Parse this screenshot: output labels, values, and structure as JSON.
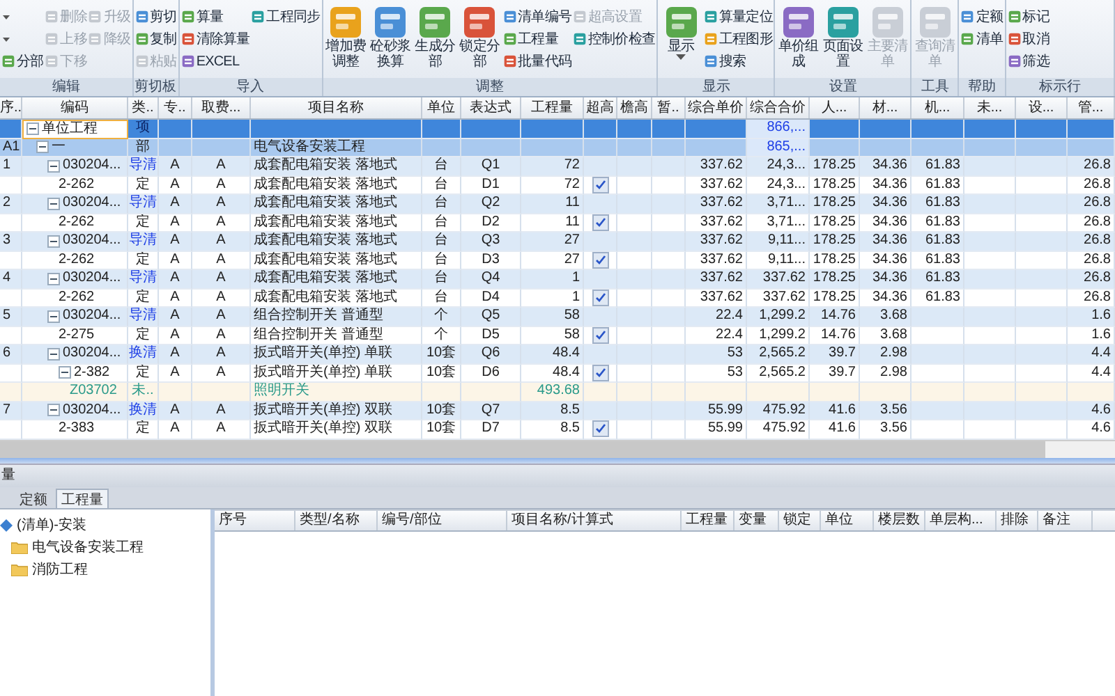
{
  "ribbon": {
    "groups": [
      {
        "label": "编辑",
        "items": [
          {
            "kind": "caret"
          },
          {
            "kind": "caret"
          },
          {
            "kind": "small",
            "label": "分部",
            "disabled": false
          },
          {
            "kind": "small",
            "label": "删除",
            "disabled": true
          },
          {
            "kind": "small",
            "label": "上移",
            "disabled": true
          },
          {
            "kind": "small",
            "label": "下移",
            "disabled": true
          },
          {
            "kind": "small",
            "label": "升级",
            "disabled": true
          },
          {
            "kind": "small",
            "label": "降级",
            "disabled": true
          }
        ]
      },
      {
        "label": "剪切板",
        "items": [
          {
            "kind": "small",
            "label": "剪切",
            "disabled": false
          },
          {
            "kind": "small",
            "label": "复制",
            "disabled": false
          },
          {
            "kind": "small",
            "label": "粘贴",
            "disabled": true
          }
        ]
      },
      {
        "label": "导入",
        "items": [
          {
            "kind": "small",
            "label": "算量",
            "disabled": false
          },
          {
            "kind": "small",
            "label": "清除算量",
            "disabled": false
          },
          {
            "kind": "small",
            "label": "EXCEL",
            "disabled": false
          },
          {
            "kind": "small",
            "label": "工程同步",
            "disabled": false
          }
        ]
      },
      {
        "label": "调整",
        "items": [
          {
            "kind": "large",
            "label": "增加费调整",
            "disabled": false
          },
          {
            "kind": "large",
            "label": "砼砂浆换算",
            "disabled": false
          },
          {
            "kind": "large",
            "label": "生成分部",
            "disabled": false
          },
          {
            "kind": "large",
            "label": "锁定分部",
            "disabled": false
          },
          {
            "kind": "small",
            "label": "清单编号",
            "disabled": false
          },
          {
            "kind": "small",
            "label": "工程量",
            "disabled": false
          },
          {
            "kind": "small",
            "label": "批量代码",
            "disabled": false
          },
          {
            "kind": "small",
            "label": "超高设置",
            "disabled": true
          },
          {
            "kind": "small",
            "label": "控制价检查",
            "disabled": false
          }
        ]
      },
      {
        "label": "显示",
        "items": [
          {
            "kind": "menu",
            "label": "显示",
            "disabled": false
          },
          {
            "kind": "small",
            "label": "算量定位",
            "disabled": false
          },
          {
            "kind": "small",
            "label": "工程图形",
            "disabled": false
          },
          {
            "kind": "small",
            "label": "搜索",
            "disabled": false
          }
        ]
      },
      {
        "label": "设置",
        "items": [
          {
            "kind": "large",
            "label": "单价组成",
            "disabled": false
          },
          {
            "kind": "large",
            "label": "页面设置",
            "disabled": false
          },
          {
            "kind": "large",
            "label": "主要清单",
            "disabled": true
          }
        ]
      },
      {
        "label": "工具",
        "items": [
          {
            "kind": "large",
            "label": "查询清单",
            "disabled": true
          }
        ]
      },
      {
        "label": "帮助",
        "items": [
          {
            "kind": "small",
            "label": "定额",
            "disabled": false
          },
          {
            "kind": "small",
            "label": "清单",
            "disabled": false
          }
        ]
      },
      {
        "label": "标示行",
        "items": [
          {
            "kind": "small",
            "label": "标记",
            "disabled": false
          },
          {
            "kind": "small",
            "label": "取消",
            "disabled": false
          },
          {
            "kind": "small",
            "label": "筛选",
            "disabled": false
          }
        ]
      }
    ]
  },
  "table": {
    "columns": [
      "序..",
      "编码",
      "类..",
      "专..",
      "取费...",
      "项目名称",
      "单位",
      "表达式",
      "工程量",
      "超高",
      "檐高",
      "暂..",
      "综合单价",
      "综合合价",
      "人...",
      "材...",
      "机...",
      "未...",
      "设...",
      "管..."
    ],
    "rows": [
      {
        "kind": "unit",
        "selected": true,
        "code": "单位工程",
        "type": "项",
        "total": "866,...",
        "children": [
          {
            "kind": "section",
            "selected": false,
            "no": "A1",
            "code": "一",
            "type": "部",
            "name": "电气设备安装工程",
            "total": "865,...",
            "children": [
              {
                "kind": "bill",
                "selected": false,
                "no": "1",
                "code": "030204...",
                "type": "导清",
                "spec": "A",
                "fee": "A",
                "name": "成套配电箱安装 落地式",
                "unit": "台",
                "expr": "Q1",
                "qty": "72",
                "unit_price": "337.62",
                "total": "24,3...",
                "labor": "178.25",
                "material": "34.36",
                "machine": "61.83",
                "manage": "26.8",
                "children": [
                  {
                    "kind": "quota",
                    "selected": false,
                    "code": "2-262",
                    "type": "定",
                    "spec": "A",
                    "fee": "A",
                    "name": "成套配电箱安装 落地式",
                    "unit": "台",
                    "expr": "D1",
                    "qty": "72",
                    "over_height": true,
                    "unit_price": "337.62",
                    "total": "24,3...",
                    "labor": "178.25",
                    "material": "34.36",
                    "machine": "61.83",
                    "manage": "26.8"
                  }
                ]
              },
              {
                "kind": "bill",
                "selected": false,
                "no": "2",
                "code": "030204...",
                "type": "导清",
                "spec": "A",
                "fee": "A",
                "name": "成套配电箱安装 落地式",
                "unit": "台",
                "expr": "Q2",
                "qty": "11",
                "unit_price": "337.62",
                "total": "3,71...",
                "labor": "178.25",
                "material": "34.36",
                "machine": "61.83",
                "manage": "26.8",
                "children": [
                  {
                    "kind": "quota",
                    "selected": false,
                    "code": "2-262",
                    "type": "定",
                    "spec": "A",
                    "fee": "A",
                    "name": "成套配电箱安装 落地式",
                    "unit": "台",
                    "expr": "D2",
                    "qty": "11",
                    "over_height": true,
                    "unit_price": "337.62",
                    "total": "3,71...",
                    "labor": "178.25",
                    "material": "34.36",
                    "machine": "61.83",
                    "manage": "26.8"
                  }
                ]
              },
              {
                "kind": "bill",
                "selected": false,
                "no": "3",
                "code": "030204...",
                "type": "导清",
                "spec": "A",
                "fee": "A",
                "name": "成套配电箱安装 落地式",
                "unit": "台",
                "expr": "Q3",
                "qty": "27",
                "unit_price": "337.62",
                "total": "9,11...",
                "labor": "178.25",
                "material": "34.36",
                "machine": "61.83",
                "manage": "26.8",
                "children": [
                  {
                    "kind": "quota",
                    "selected": false,
                    "code": "2-262",
                    "type": "定",
                    "spec": "A",
                    "fee": "A",
                    "name": "成套配电箱安装 落地式",
                    "unit": "台",
                    "expr": "D3",
                    "qty": "27",
                    "over_height": true,
                    "unit_price": "337.62",
                    "total": "9,11...",
                    "labor": "178.25",
                    "material": "34.36",
                    "machine": "61.83",
                    "manage": "26.8"
                  }
                ]
              },
              {
                "kind": "bill",
                "selected": false,
                "no": "4",
                "code": "030204...",
                "type": "导清",
                "spec": "A",
                "fee": "A",
                "name": "成套配电箱安装 落地式",
                "unit": "台",
                "expr": "Q4",
                "qty": "1",
                "unit_price": "337.62",
                "total": "337.62",
                "labor": "178.25",
                "material": "34.36",
                "machine": "61.83",
                "manage": "26.8",
                "children": [
                  {
                    "kind": "quota",
                    "selected": false,
                    "code": "2-262",
                    "type": "定",
                    "spec": "A",
                    "fee": "A",
                    "name": "成套配电箱安装 落地式",
                    "unit": "台",
                    "expr": "D4",
                    "qty": "1",
                    "over_height": true,
                    "unit_price": "337.62",
                    "total": "337.62",
                    "labor": "178.25",
                    "material": "34.36",
                    "machine": "61.83",
                    "manage": "26.8"
                  }
                ]
              },
              {
                "kind": "bill",
                "selected": false,
                "no": "5",
                "code": "030204...",
                "type": "导清",
                "spec": "A",
                "fee": "A",
                "name": "组合控制开关 普通型",
                "unit": "个",
                "expr": "Q5",
                "qty": "58",
                "unit_price": "22.4",
                "total": "1,299.2",
                "labor": "14.76",
                "material": "3.68",
                "manage": "1.6",
                "children": [
                  {
                    "kind": "quota",
                    "selected": false,
                    "code": "2-275",
                    "type": "定",
                    "spec": "A",
                    "fee": "A",
                    "name": "组合控制开关 普通型",
                    "unit": "个",
                    "expr": "D5",
                    "qty": "58",
                    "over_height": true,
                    "unit_price": "22.4",
                    "total": "1,299.2",
                    "labor": "14.76",
                    "material": "3.68",
                    "manage": "1.6"
                  }
                ]
              },
              {
                "kind": "bill",
                "selected": false,
                "no": "6",
                "code": "030204...",
                "type": "换清",
                "spec": "A",
                "fee": "A",
                "name": "扳式暗开关(单控) 单联",
                "unit": "10套",
                "expr": "Q6",
                "qty": "48.4",
                "unit_price": "53",
                "total": "2,565.2",
                "labor": "39.7",
                "material": "2.98",
                "manage": "4.4",
                "children": [
                  {
                    "kind": "quota",
                    "selected": false,
                    "code": "2-382",
                    "type": "定",
                    "spec": "A",
                    "fee": "A",
                    "name": "扳式暗开关(单控) 单联",
                    "unit": "10套",
                    "expr": "D6",
                    "qty": "48.4",
                    "over_height": true,
                    "unit_price": "53",
                    "total": "2,565.2",
                    "labor": "39.7",
                    "material": "2.98",
                    "manage": "4.4",
                    "children": [
                      {
                        "kind": "material",
                        "selected": false,
                        "code": "Z03702",
                        "type": "未..",
                        "name": "照明开关",
                        "qty": "493.68"
                      }
                    ]
                  }
                ]
              },
              {
                "kind": "bill",
                "selected": false,
                "no": "7",
                "code": "030204...",
                "type": "换清",
                "spec": "A",
                "fee": "A",
                "name": "扳式暗开关(单控) 双联",
                "unit": "10套",
                "expr": "Q7",
                "qty": "8.5",
                "unit_price": "55.99",
                "total": "475.92",
                "labor": "41.6",
                "material": "3.56",
                "manage": "4.6",
                "children": [
                  {
                    "kind": "quota",
                    "selected": false,
                    "code": "2-383",
                    "type": "定",
                    "spec": "A",
                    "fee": "A",
                    "name": "扳式暗开关(单控) 双联",
                    "unit": "10套",
                    "expr": "D7",
                    "qty": "8.5",
                    "over_height": true,
                    "unit_price": "55.99",
                    "total": "475.92",
                    "labor": "41.6",
                    "material": "3.56",
                    "manage": "4.6"
                  }
                ]
              }
            ]
          }
        ]
      }
    ]
  },
  "panel": {
    "title": "量",
    "tabs": [
      {
        "label": "定额",
        "selected": false
      },
      {
        "label": "工程量",
        "selected": true
      }
    ],
    "tree": [
      {
        "label": "(清单)-安装",
        "children": [
          {
            "label": "电气设备安装工程"
          },
          {
            "label": "消防工程"
          }
        ]
      }
    ],
    "columns": [
      "序号",
      "类型/名称",
      "编号/部位",
      "项目名称/计算式",
      "工程量",
      "变量",
      "锁定",
      "单位",
      "楼层数",
      "单层构...",
      "排除",
      "备注"
    ]
  }
}
